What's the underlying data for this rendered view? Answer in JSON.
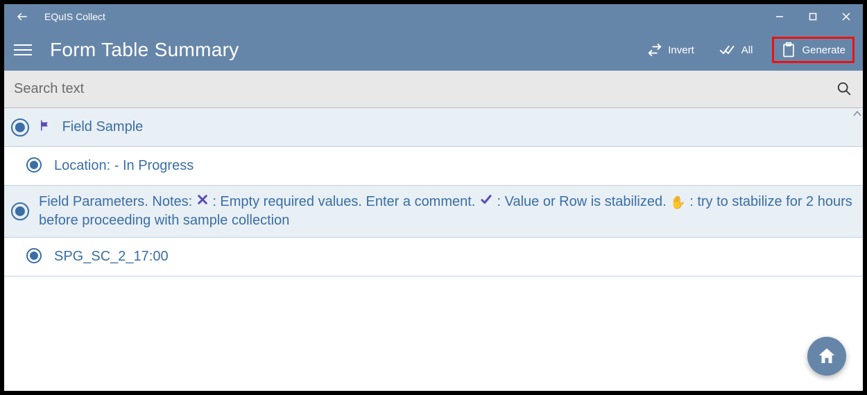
{
  "titlebar": {
    "app_name": "EQuIS Collect"
  },
  "appbar": {
    "page_title": "Form Table Summary",
    "actions": {
      "invert": "Invert",
      "all": "All",
      "generate": "Generate"
    }
  },
  "search": {
    "placeholder": "Search text"
  },
  "rows": {
    "r0_label": "Field Sample",
    "r1_prefix": "Location:  ",
    "r1_status": "- In Progress",
    "r2_pre": "Field Parameters. Notes: ",
    "r2_seg_x": " : Empty required values. Enter a comment.   ",
    "r2_seg_check": " : Value or Row is stabilized. ",
    "r2_seg_hand": " : try to stabilize for 2 hours before proceeding with sample collection",
    "r3_label": "SPG_SC_2_17:00"
  },
  "icons": {
    "back": "back-arrow-icon",
    "minimize": "minimize-icon",
    "maximize": "maximize-icon",
    "close": "close-icon",
    "menu": "hamburger-icon",
    "invert": "swap-icon",
    "all": "double-check-icon",
    "generate": "clipboard-icon",
    "search": "search-icon",
    "flag": "flag-icon",
    "x": "x-mark-icon",
    "check": "check-mark-icon",
    "hand": "raised-hand-icon",
    "home": "home-icon"
  },
  "colors": {
    "accent": "#6686a9",
    "link": "#3a6ea5",
    "shaded_row": "#e8eff5",
    "highlight_border": "#ee1111"
  }
}
